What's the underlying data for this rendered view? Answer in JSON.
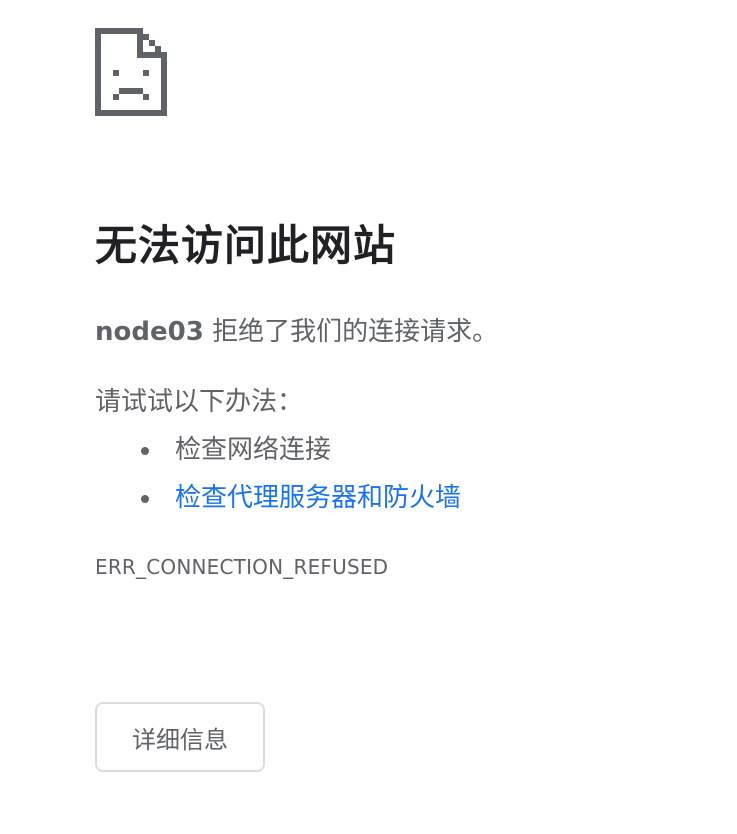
{
  "error_page": {
    "icon": "sad-document-icon",
    "title": "无法访问此网站",
    "host": "node03",
    "message": " 拒绝了我们的连接请求。",
    "suggestions_heading": "请试试以下办法：",
    "suggestions": [
      {
        "label": "检查网络连接",
        "is_link": false
      },
      {
        "label": "检查代理服务器和防火墙",
        "is_link": true
      }
    ],
    "error_code": "ERR_CONNECTION_REFUSED",
    "details_button_label": "详细信息"
  },
  "colors": {
    "title": "#202124",
    "body_text": "#5f6368",
    "link": "#1a73e8",
    "button_border": "#dadce0",
    "icon": "#5f6368"
  }
}
